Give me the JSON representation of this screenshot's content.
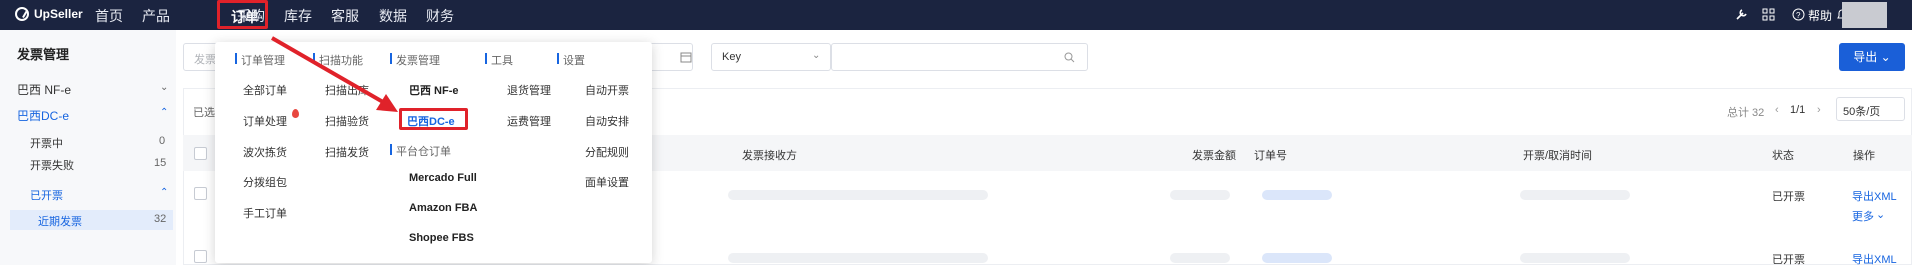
{
  "topnav": {
    "logo": "UpSeller",
    "items": [
      "首页",
      "产品",
      "订单",
      "采购",
      "库存",
      "客服",
      "数据",
      "财务"
    ],
    "active": "订单",
    "help": "帮助"
  },
  "sidebar": {
    "title": "发票管理",
    "groups": [
      {
        "label": "巴西 NF-e"
      },
      {
        "label": "巴西DC-e"
      }
    ],
    "dce_items": [
      {
        "label": "开票中",
        "count": "0"
      },
      {
        "label": "开票失败",
        "count": "15"
      }
    ],
    "issued": {
      "label": "已开票",
      "sub": "近期发票",
      "count": "32"
    }
  },
  "filter": {
    "search_placeholder": "发票",
    "key_select": "Key",
    "export_label": "导出"
  },
  "pagination": {
    "total": "总计 32",
    "page": "1/1",
    "page_size": "50条/页"
  },
  "table": {
    "selected_prefix": "已选",
    "headers": [
      "发票接收方",
      "发票金额",
      "订单号",
      "开票/取消时间",
      "状态",
      "操作"
    ],
    "rows": [
      {
        "status": "已开票",
        "action": "导出XML",
        "more": "更多"
      },
      {
        "status": "已开票",
        "action": "导出XML"
      }
    ]
  },
  "dropdown": {
    "sections": {
      "order_mgmt": {
        "title": "订单管理",
        "items": [
          "全部订单",
          "订单处理",
          "波次拣货",
          "分拨组包",
          "手工订单"
        ]
      },
      "scan": {
        "title": "扫描功能",
        "items": [
          "扫描出库",
          "扫描验货",
          "扫描发货"
        ]
      },
      "invoice": {
        "title": "发票管理",
        "items": [
          "巴西 NF-e",
          "巴西DC-e"
        ]
      },
      "platform": {
        "title": "平台仓订单",
        "items": [
          "Mercado Full",
          "Amazon FBA",
          "Shopee FBS"
        ]
      },
      "tools": {
        "title": "工具",
        "items": [
          "退货管理",
          "运费管理"
        ]
      },
      "settings": {
        "title": "设置",
        "items": [
          "自动开票",
          "自动安排",
          "分配规则",
          "面单设置"
        ]
      }
    }
  },
  "colors": {
    "nav_bg": "#1b2440",
    "accent": "#1765e0",
    "highlight_red": "#e0222a"
  }
}
